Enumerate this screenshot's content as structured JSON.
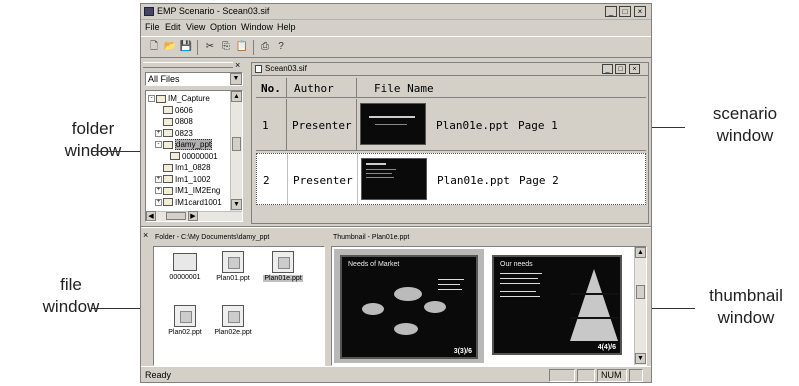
{
  "window": {
    "title": "EMP Scenario - Scean03.sif",
    "controls": [
      "_",
      "□",
      "×"
    ]
  },
  "menubar": {
    "items": [
      "File",
      "Edit",
      "View",
      "Option",
      "Window",
      "Help"
    ]
  },
  "toolbar": {
    "icons": [
      "new-icon",
      "open-icon",
      "save-icon",
      "cut-icon",
      "copy-icon",
      "paste-icon",
      "print-icon",
      "help-icon"
    ]
  },
  "folder_window": {
    "filter": "All Files",
    "tree": [
      {
        "label": "IM_Capture",
        "expand": "-",
        "level": 0
      },
      {
        "label": "0606",
        "expand": "",
        "level": 1
      },
      {
        "label": "0808",
        "expand": "",
        "level": 1
      },
      {
        "label": "0823",
        "expand": "+",
        "level": 1
      },
      {
        "label": "damy_ppt",
        "expand": "-",
        "level": 1,
        "selected": true
      },
      {
        "label": "00000001",
        "expand": "",
        "level": 2
      },
      {
        "label": "Im1_0828",
        "expand": "",
        "level": 1
      },
      {
        "label": "Im1_1002",
        "expand": "+",
        "level": 1
      },
      {
        "label": "IM1_IM2Eng",
        "expand": "+",
        "level": 1
      },
      {
        "label": "IM1card1001",
        "expand": "+",
        "level": 1
      }
    ]
  },
  "scenario_window": {
    "title": "Scean03.sif",
    "headers": [
      "No.",
      "Author",
      "File Name"
    ],
    "rows": [
      {
        "no": "1",
        "author": "Presenter",
        "file": "Plan01e.ppt",
        "page": "Page 1"
      },
      {
        "no": "2",
        "author": "Presenter",
        "file": "Plan01e.ppt",
        "page": "Page 2"
      }
    ]
  },
  "file_window": {
    "path": "Folder - C:\\My Documents\\damy_ppt",
    "items": [
      {
        "label": "00000001",
        "kind": "folder"
      },
      {
        "label": "Plan01.ppt",
        "kind": "file"
      },
      {
        "label": "Plan01e.ppt",
        "kind": "file",
        "selected": true
      },
      {
        "label": "Plan02.ppt",
        "kind": "file"
      },
      {
        "label": "Plan02e.ppt",
        "kind": "file"
      }
    ]
  },
  "thumbnail_window": {
    "title": "Thumbnail - Plan01e.ppt",
    "thumbs": [
      {
        "heading": "Needs of Market",
        "caption": "3(3)/6"
      },
      {
        "heading": "Our needs",
        "caption": "4(4)/6"
      }
    ]
  },
  "statusbar": {
    "text": "Ready",
    "num": "NUM"
  },
  "callouts": {
    "folder_window": "folder\nwindow",
    "scenario_window": "scenario\nwindow",
    "file_window": "file\nwindow",
    "thumbnail_window": "thumbnail\nwindow"
  }
}
